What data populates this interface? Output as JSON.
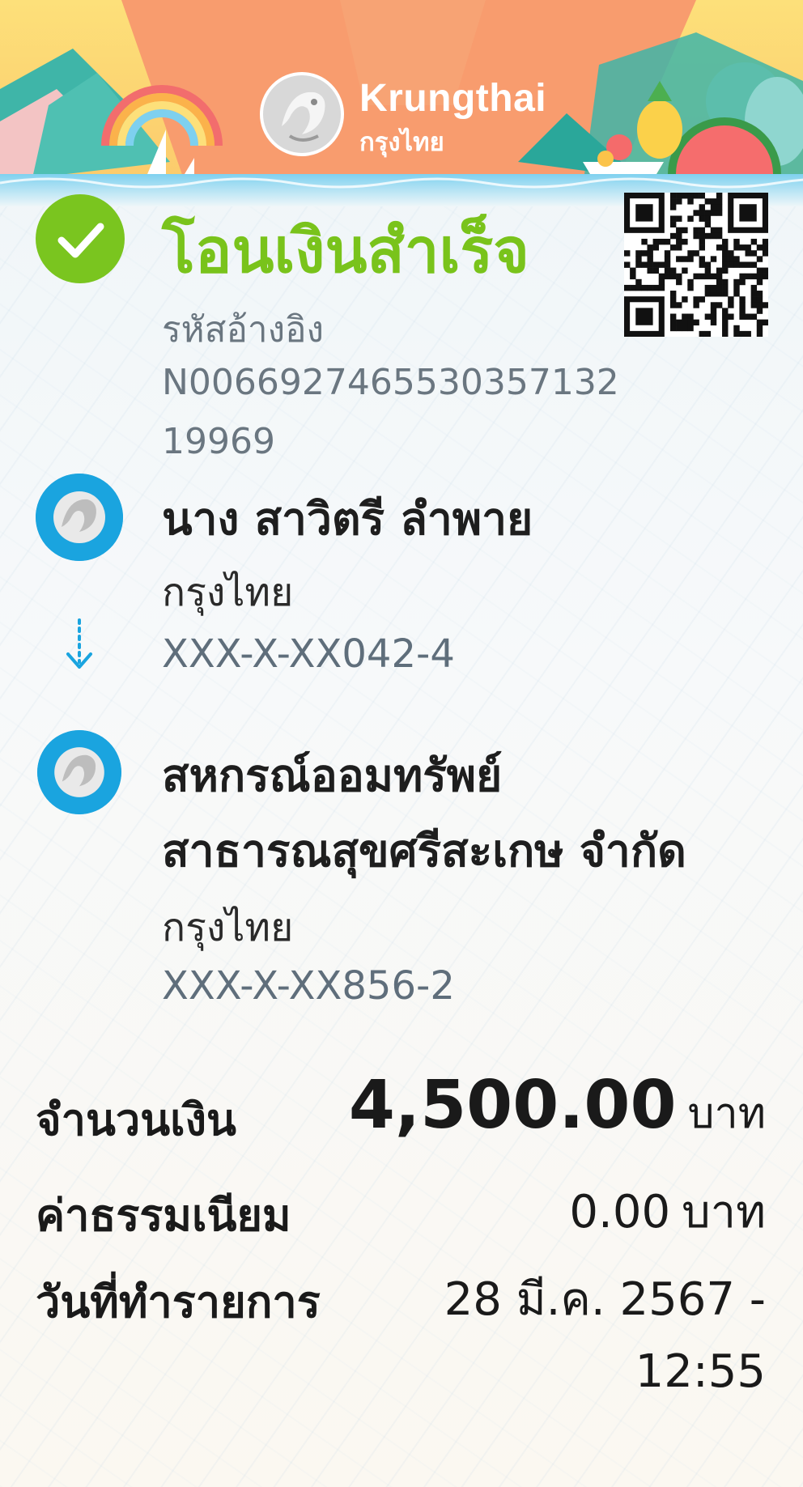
{
  "brand": {
    "name": "Krungthai",
    "name_thai": "กรุงไทย"
  },
  "status": {
    "title": "โอนเงินสำเร็จ"
  },
  "reference": {
    "label": "รหัสอ้างอิง",
    "code_line1": "N0066927465530357132",
    "code_line2": "19969"
  },
  "sender": {
    "name": "นาง สาวิตรี ลำพาย",
    "bank": "กรุงไทย",
    "account": "XXX-X-XX042-4"
  },
  "receiver": {
    "name_line1": "สหกรณ์ออมทรัพย์",
    "name_line2": "สาธารณสุขศรีสะเกษ จำกัด",
    "bank": "กรุงไทย",
    "account": "XXX-X-XX856-2"
  },
  "summary": {
    "amount_label": "จำนวนเงิน",
    "amount_value": "4,500.00",
    "fee_label": "ค่าธรรมเนียม",
    "fee_value": "0.00",
    "currency": "บาท",
    "date_label": "วันที่ทำรายการ",
    "date_value": "28 มี.ค. 2567 -",
    "time_value": "12:55"
  },
  "icons": {
    "status": "check-circle-icon",
    "bank": "krungthai-emblem-icon",
    "transfer": "dotted-arrow-down-icon",
    "qr": "qr-code"
  },
  "colors": {
    "success": "#7ac51f",
    "bank_blue": "#1aa4df",
    "banner_orange": "#f79a6c",
    "banner_yellow": "#fdd365"
  }
}
